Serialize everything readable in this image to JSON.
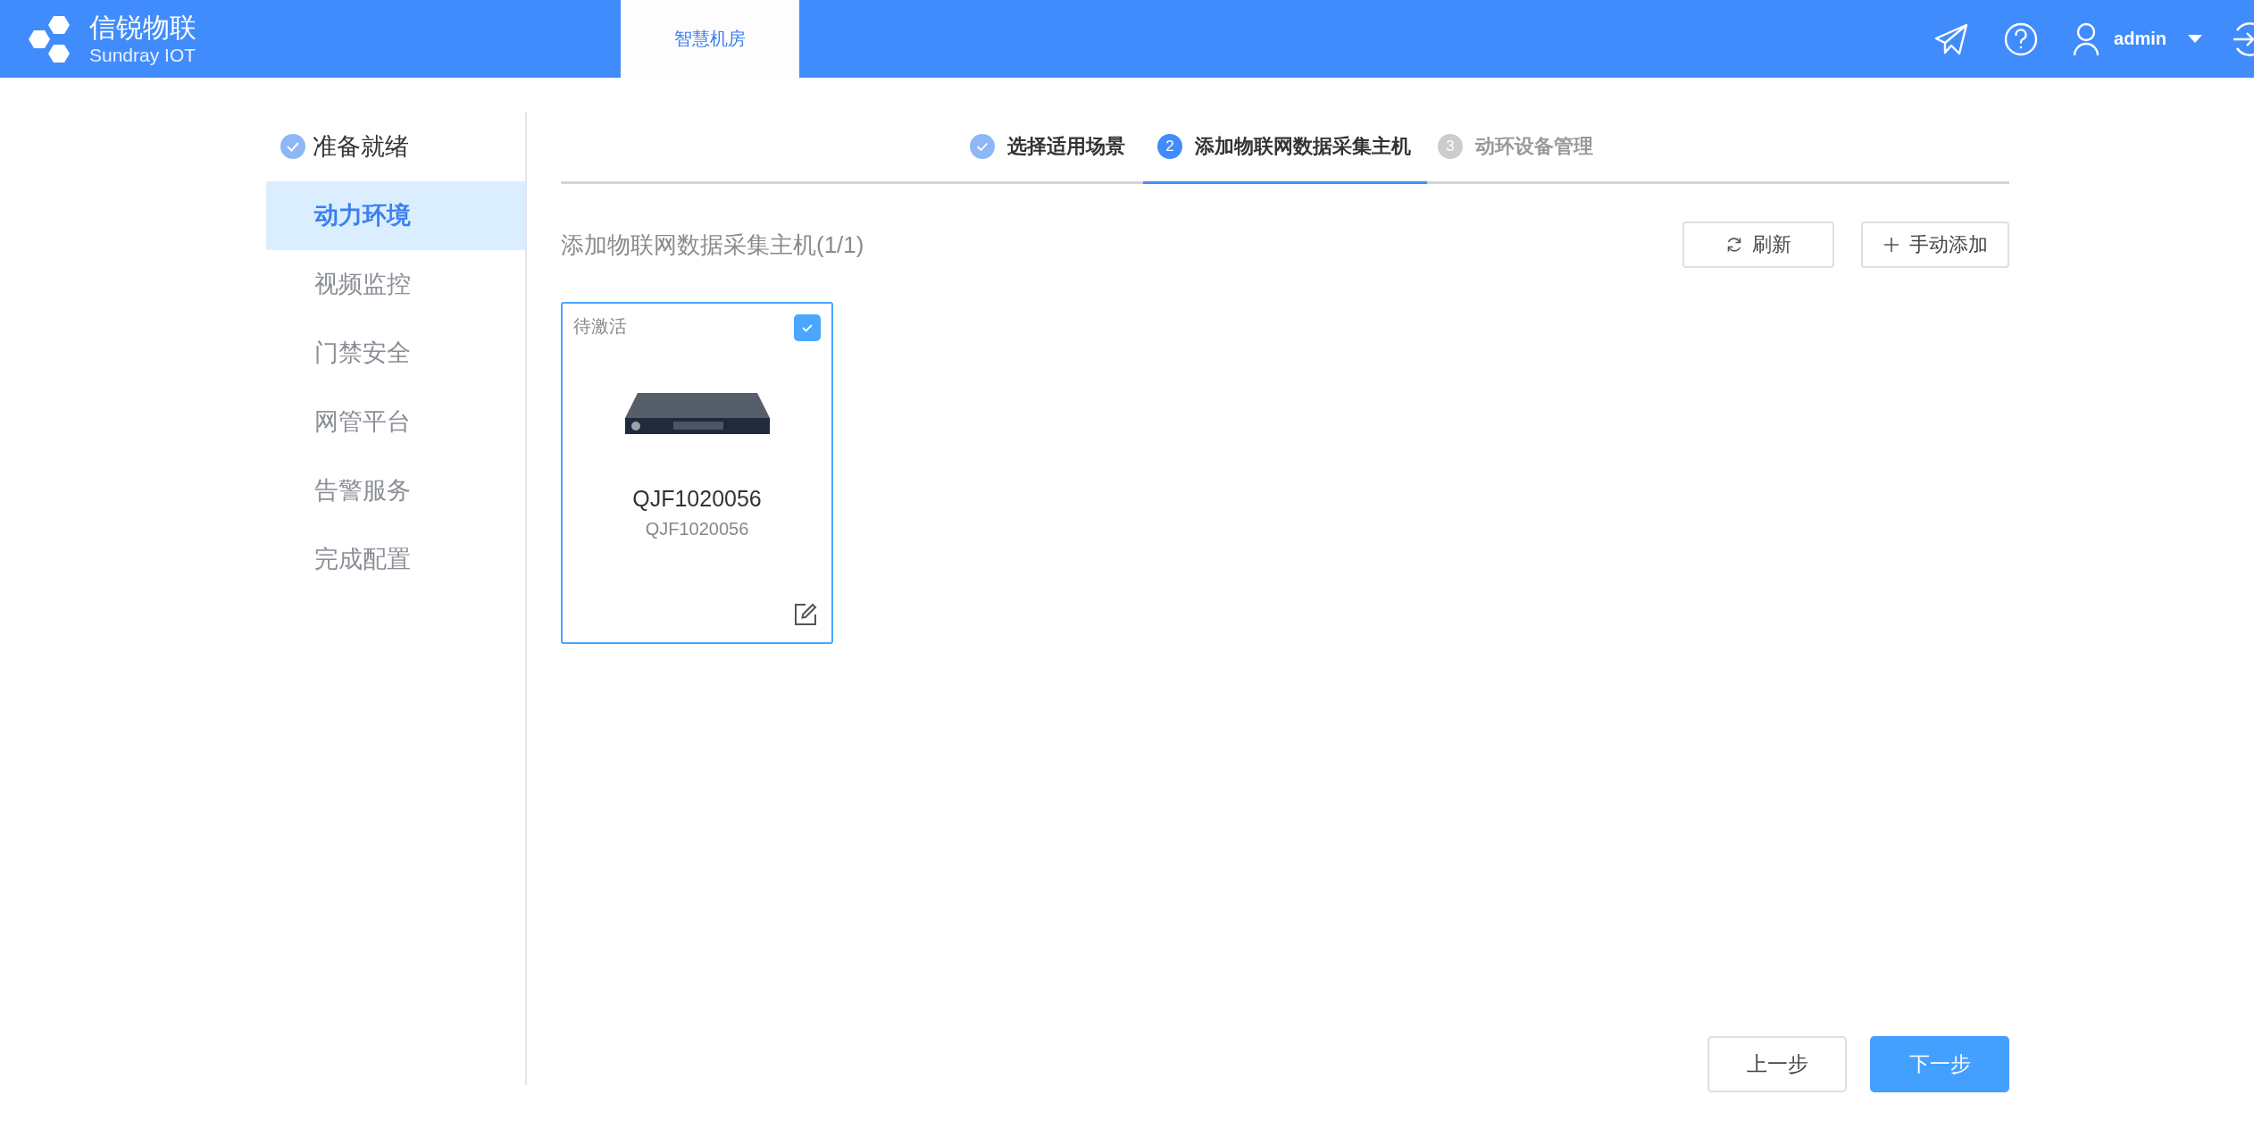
{
  "header": {
    "logo_title": "信锐物联",
    "logo_subtitle": "Sundray IOT",
    "nav_tabs": [
      {
        "label": "智慧机房",
        "selected": true
      }
    ],
    "user": "admin"
  },
  "sidebar": {
    "items": [
      {
        "label": "准备就绪",
        "kind": "header",
        "done": true
      },
      {
        "label": "动力环境",
        "kind": "item",
        "selected": true
      },
      {
        "label": "视频监控",
        "kind": "item",
        "selected": false
      },
      {
        "label": "门禁安全",
        "kind": "item",
        "selected": false
      },
      {
        "label": "网管平台",
        "kind": "item",
        "selected": false
      },
      {
        "label": "告警服务",
        "kind": "item",
        "selected": false
      },
      {
        "label": "完成配置",
        "kind": "item",
        "selected": false
      }
    ]
  },
  "steps": [
    {
      "label": "选择适用场景",
      "done": true,
      "selected": false
    },
    {
      "number": "2",
      "label": "添加物联网数据采集主机",
      "done": false,
      "selected": true
    },
    {
      "number": "3",
      "label": "动环设备管理",
      "done": false,
      "selected": false
    }
  ],
  "section": {
    "title": "添加物联网数据采集主机(1/1)",
    "buttons": [
      {
        "label": "刷新",
        "kind": "refresh"
      },
      {
        "label": "手动添加",
        "kind": "add"
      }
    ]
  },
  "devices": [
    {
      "status": "待激活",
      "checked": true,
      "name": "QJF1020056",
      "serial": "QJF1020056"
    }
  ],
  "footer": {
    "prev": "上一步",
    "next": "下一步"
  }
}
